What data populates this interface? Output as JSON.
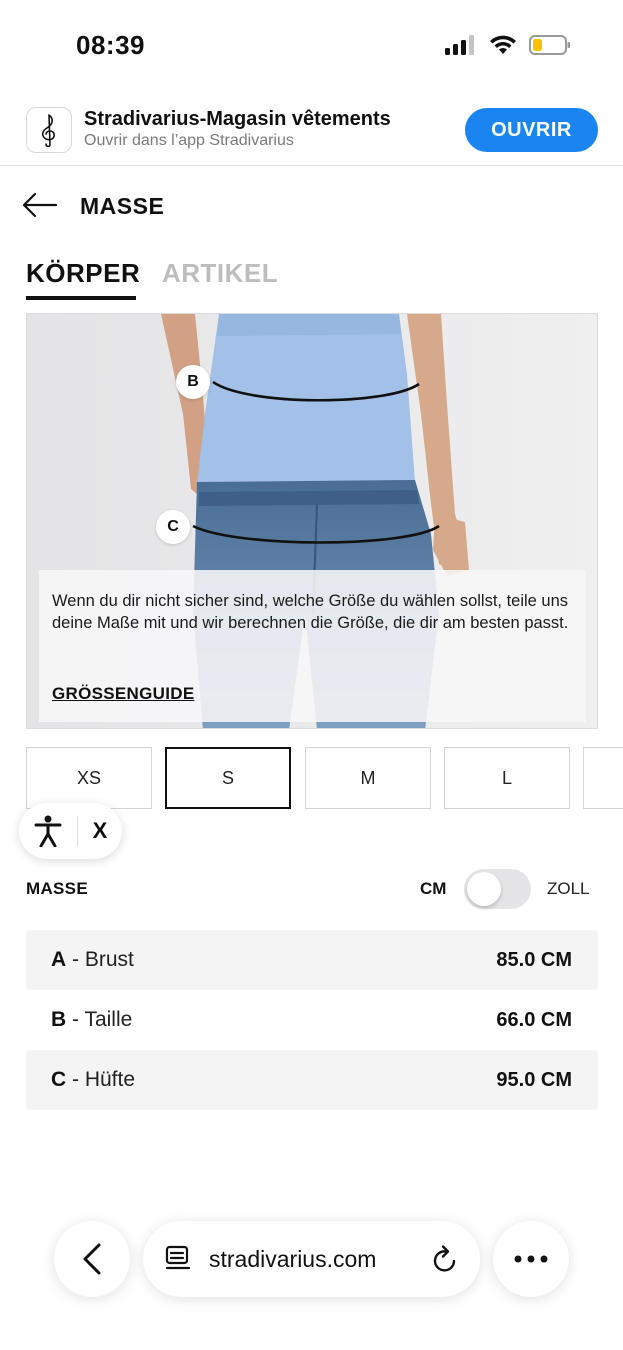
{
  "status_bar": {
    "time": "08:39"
  },
  "app_banner": {
    "title": "Stradivarius-Magasin vêtements",
    "subtitle": "Ouvrir dans l’app Stradivarius",
    "open_label": "OUVRIR",
    "accent_color": "#1a85f0"
  },
  "header": {
    "title": "MASSE",
    "back_icon": "arrow-left-icon"
  },
  "tabs": [
    {
      "label": "KÖRPER",
      "active": true
    },
    {
      "label": "ARTIKEL",
      "active": false
    }
  ],
  "figure": {
    "markers": [
      "B",
      "C"
    ],
    "info_text": "Wenn du dir nicht sicher sind, welche Größe du wählen sollst, teile uns deine Maße mit und wir berechnen die Größe, die dir am besten passt.",
    "guide_link": "GRÖSSENGUIDE"
  },
  "sizes": {
    "options": [
      "XS",
      "S",
      "M",
      "L"
    ],
    "selected": "S"
  },
  "accessibility": {
    "icon": "accessibility-icon",
    "close_label": "X"
  },
  "measurements": {
    "label": "MASSE",
    "unit_primary": "CM",
    "unit_secondary": "ZOLL",
    "rows": [
      {
        "letter": "A",
        "name": " - Brust",
        "value": "85.0 CM"
      },
      {
        "letter": "B",
        "name": " - Taille",
        "value": "66.0 CM"
      },
      {
        "letter": "C",
        "name": " - Hüfte",
        "value": "95.0 CM"
      }
    ]
  },
  "browser_bar": {
    "url": "stradivarius.com",
    "icons": [
      "chevron-left-icon",
      "reader-icon",
      "reload-icon",
      "more-icon"
    ]
  }
}
